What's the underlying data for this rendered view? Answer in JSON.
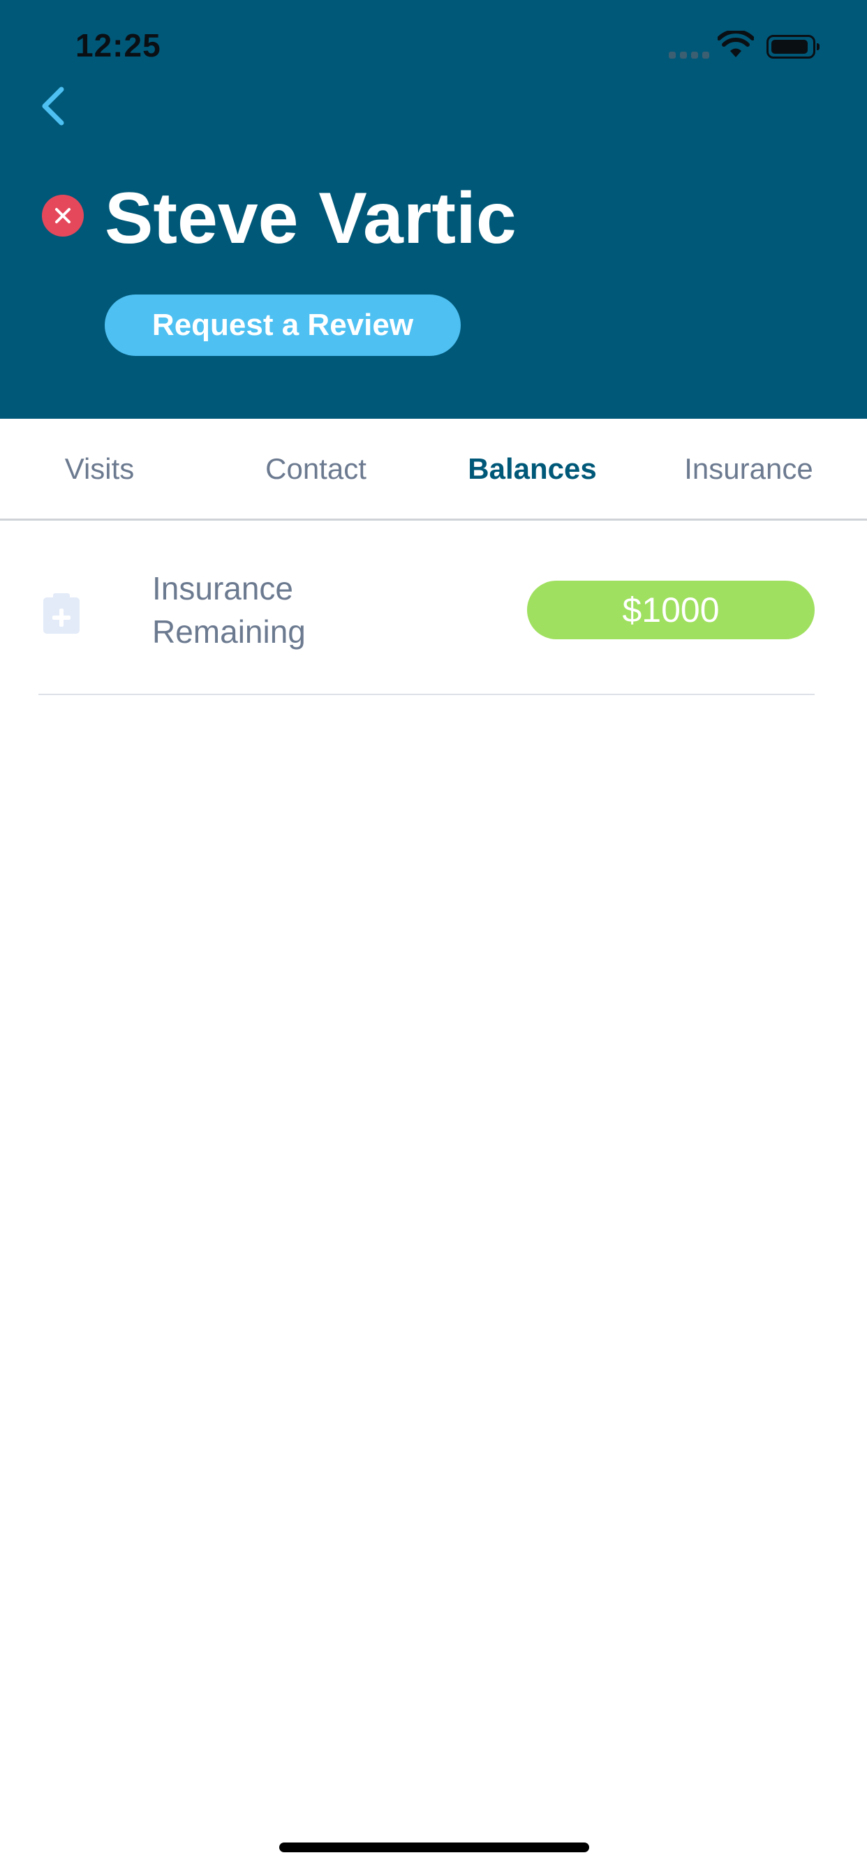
{
  "status_bar": {
    "time": "12:25"
  },
  "header": {
    "patient_name": "Steve Vartic",
    "status_color": "#e5485b",
    "request_review_label": "Request a Review",
    "background_color": "#005878"
  },
  "tabs": [
    {
      "label": "Visits",
      "active": false
    },
    {
      "label": "Contact",
      "active": false
    },
    {
      "label": "Balances",
      "active": true
    },
    {
      "label": "Insurance",
      "active": false
    }
  ],
  "balances": [
    {
      "icon": "clipboard-plus-icon",
      "label_line1": "Insurance",
      "label_line2": "Remaining",
      "amount": "$1000",
      "amount_color": "#a0e060"
    }
  ],
  "colors": {
    "accent": "#4ec0f2",
    "tab_active": "#005878",
    "tab_inactive": "#6c7a90"
  }
}
